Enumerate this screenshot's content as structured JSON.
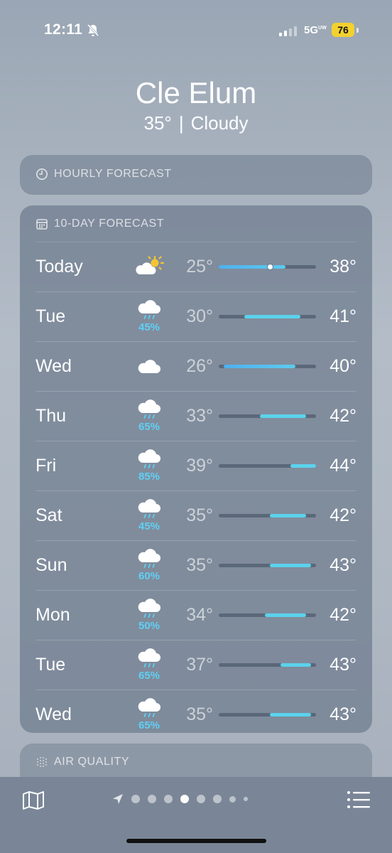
{
  "status": {
    "time": "12:11",
    "network": "5G",
    "network_suffix": "UW",
    "battery": "76"
  },
  "header": {
    "city": "Cle Elum",
    "temp": "35°",
    "separator": "|",
    "condition": "Cloudy"
  },
  "hourly": {
    "title": "HOURLY FORECAST"
  },
  "daily": {
    "title": "10-DAY FORECAST",
    "range_min": 25,
    "range_max": 44,
    "days": [
      {
        "day": "Today",
        "icon": "partly-sunny-icon",
        "pct": "",
        "lo": "25°",
        "hi": "38°",
        "lo_v": 25,
        "hi_v": 38,
        "current": 35
      },
      {
        "day": "Tue",
        "icon": "rain-cloud-icon",
        "pct": "45%",
        "lo": "30°",
        "hi": "41°",
        "lo_v": 30,
        "hi_v": 41
      },
      {
        "day": "Wed",
        "icon": "cloud-icon",
        "pct": "",
        "lo": "26°",
        "hi": "40°",
        "lo_v": 26,
        "hi_v": 40
      },
      {
        "day": "Thu",
        "icon": "rain-cloud-icon",
        "pct": "65%",
        "lo": "33°",
        "hi": "42°",
        "lo_v": 33,
        "hi_v": 42
      },
      {
        "day": "Fri",
        "icon": "rain-cloud-icon",
        "pct": "85%",
        "lo": "39°",
        "hi": "44°",
        "lo_v": 39,
        "hi_v": 44
      },
      {
        "day": "Sat",
        "icon": "rain-cloud-icon",
        "pct": "45%",
        "lo": "35°",
        "hi": "42°",
        "lo_v": 35,
        "hi_v": 42
      },
      {
        "day": "Sun",
        "icon": "rain-cloud-icon",
        "pct": "60%",
        "lo": "35°",
        "hi": "43°",
        "lo_v": 35,
        "hi_v": 43
      },
      {
        "day": "Mon",
        "icon": "rain-cloud-icon",
        "pct": "50%",
        "lo": "34°",
        "hi": "42°",
        "lo_v": 34,
        "hi_v": 42
      },
      {
        "day": "Tue",
        "icon": "rain-cloud-icon",
        "pct": "65%",
        "lo": "37°",
        "hi": "43°",
        "lo_v": 37,
        "hi_v": 43
      },
      {
        "day": "Wed",
        "icon": "rain-cloud-icon",
        "pct": "65%",
        "lo": "35°",
        "hi": "43°",
        "lo_v": 35,
        "hi_v": 43
      }
    ]
  },
  "air_quality": {
    "title": "AIR QUALITY"
  },
  "colors": {
    "rain_pct": "#5fd0f5",
    "bar": "#5bd2ec",
    "battery": "#f3d12f"
  },
  "tabbar": {
    "pages": 9,
    "active_page": 4
  }
}
